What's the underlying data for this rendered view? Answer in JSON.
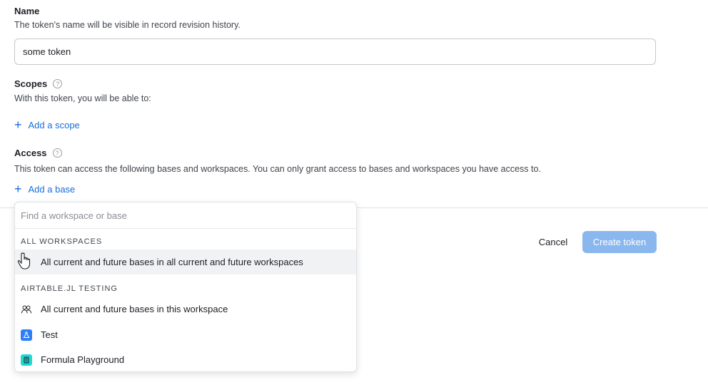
{
  "name": {
    "label": "Name",
    "help": "The token's name will be visible in record revision history.",
    "value": "some token"
  },
  "scopes": {
    "label": "Scopes",
    "help": "With this token, you will be able to:",
    "add_label": "Add a scope"
  },
  "access": {
    "label": "Access",
    "help": "This token can access the following bases and workspaces. You can only grant access to bases and workspaces you have access to.",
    "add_label": "Add a base"
  },
  "dropdown": {
    "search_placeholder": "Find a workspace or base",
    "heading_all": "ALL WORKSPACES",
    "item_all": "All current and future bases in all current and future workspaces",
    "heading_workspace": "AIRTABLE.JL TESTING",
    "item_workspace": "All current and future bases in this workspace",
    "bases": [
      {
        "name": "Test",
        "color": "#2d7ff9",
        "icon": "flask-icon"
      },
      {
        "name": "Formula Playground",
        "color": "#20d9d2",
        "icon": "calculator-icon"
      }
    ]
  },
  "actions": {
    "cancel_label": "Cancel",
    "create_label": "Create token"
  },
  "colors": {
    "accent": "#166ee1",
    "create_button_disabled": "#8ab7ee"
  }
}
